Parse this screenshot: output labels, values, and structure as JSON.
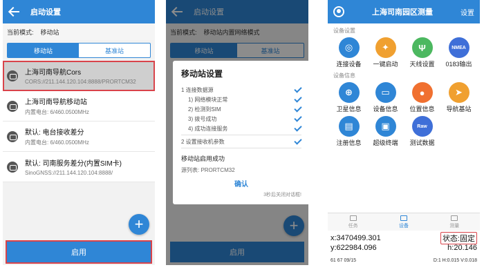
{
  "screen1": {
    "title": "启动设置",
    "mode_label": "当前模式:",
    "mode_value": "移动站",
    "tabs": [
      "移动站",
      "基准站"
    ],
    "items": [
      {
        "name": "上海司南导航Cors",
        "detail": "CORS://211.144.120.104:8888/PRORTCM32"
      },
      {
        "name": "上海司南导航移动站",
        "detail": "内置电台: 6/460.0500MHz"
      },
      {
        "name": "默认: 电台接收差分",
        "detail": "内置电台: 6/460.0500MHz"
      },
      {
        "name": "默认: 司南服务差分(内置SIM卡)",
        "detail": "SinoGNSS://211.144.120.104:8888/"
      }
    ],
    "start_button": "启用",
    "fab": "+"
  },
  "screen2": {
    "title": "启动设置",
    "mode_label": "当前模式:",
    "mode_value": "移动站内置网络模式",
    "tabs": [
      "移动站",
      "基准站"
    ],
    "dialog": {
      "title": "移动站设置",
      "step1": "1  连接数据源",
      "substeps": [
        "1)  网络模块正常",
        "2)  检测到SIM",
        "3)  拨号成功",
        "4)  成功连接服务"
      ],
      "step2": "2  设置接收机参数",
      "success": "移动站启用成功",
      "source": "源列表: PRORTCM32",
      "confirm": "确认",
      "close_hint": "3秒后关闭对话框!"
    },
    "start_button": "启用",
    "fab": "+"
  },
  "screen3": {
    "title": "上海司南园区测量",
    "settings": "设置",
    "section1": "设备设置",
    "grid1": [
      {
        "label": "连接设备",
        "icon": "connect-device-icon",
        "color": "#2f86d6",
        "glyph": "◎"
      },
      {
        "label": "一键启动",
        "icon": "one-key-start-icon",
        "color": "#f0a030",
        "glyph": "✦"
      },
      {
        "label": "天线设置",
        "icon": "antenna-icon",
        "color": "#4cb860",
        "glyph": "Ψ"
      },
      {
        "label": "0183输出",
        "icon": "nmea-icon",
        "color": "#3f6fd8",
        "glyph": "NMEA"
      }
    ],
    "section2": "设备信息",
    "grid2": [
      {
        "label": "卫星信息",
        "icon": "satellite-info-icon",
        "color": "#2f86d6",
        "glyph": "⊕"
      },
      {
        "label": "设备信息",
        "icon": "device-info-icon",
        "color": "#2f86d6",
        "glyph": "▭"
      },
      {
        "label": "位置信息",
        "icon": "location-icon",
        "color": "#f07030",
        "glyph": "●"
      },
      {
        "label": "导航基站",
        "icon": "nav-base-icon",
        "color": "#f0a030",
        "glyph": "➤"
      },
      {
        "label": "注册信息",
        "icon": "register-info-icon",
        "color": "#2f86d6",
        "glyph": "▤"
      },
      {
        "label": "超级终端",
        "icon": "terminal-icon",
        "color": "#2f86d6",
        "glyph": "▣"
      },
      {
        "label": "测试数据",
        "icon": "raw-data-icon",
        "color": "#3f6fd8",
        "glyph": "Raw"
      }
    ],
    "nav": [
      "任务",
      "设备",
      "测量"
    ],
    "x_value": "x:3470499.301",
    "y_value": "y:622984.096",
    "state": "状态:固定",
    "h_value": "h:20.146",
    "sats_left": "61  67  09/15",
    "sats_right": "D:1 H:0.015 V:0.018"
  }
}
